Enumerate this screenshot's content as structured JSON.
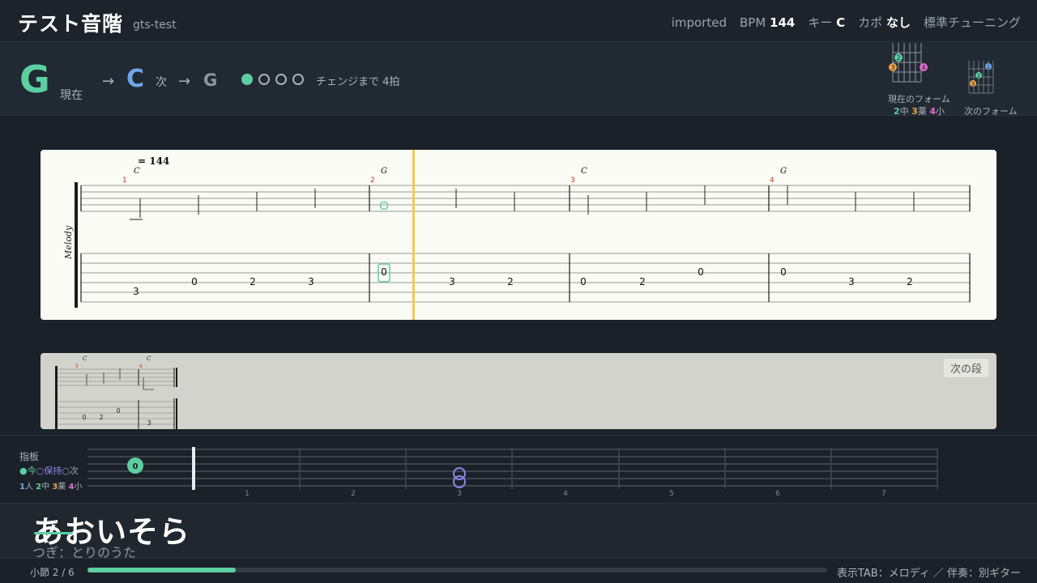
{
  "header": {
    "title": "テスト音階",
    "subtitle": "gts-test",
    "source": "imported",
    "bpm_label": "BPM",
    "bpm_value": "144",
    "key_label": "キー",
    "key_value": "C",
    "capo_label": "カポ",
    "capo_value": "なし",
    "tuning": "標準チューニング"
  },
  "chords": {
    "current": "G",
    "current_label": "現在",
    "arrow": "→",
    "next": "C",
    "next_label": "次",
    "after": "G",
    "beats_total": 4,
    "beats_done": 1,
    "change_text": "チェンジまで 4拍"
  },
  "diagrams": {
    "current_label": "現在のフォーム",
    "next_label": "次のフォーム",
    "finger_legend": [
      {
        "num": "2",
        "text": "中",
        "color": "#5ccfa0"
      },
      {
        "num": "3",
        "text": "薬",
        "color": "#f0a24a"
      },
      {
        "num": "4",
        "text": "小",
        "color": "#e46bd0"
      }
    ],
    "current_dots": [
      "2",
      "3",
      "4"
    ],
    "next_dots": [
      "1",
      "2",
      "3"
    ]
  },
  "score": {
    "tempo": "= 144",
    "track_name": "Melody",
    "measures": [
      {
        "num": "1",
        "chord": "C"
      },
      {
        "num": "2",
        "chord": "G"
      },
      {
        "num": "3",
        "chord": "C"
      },
      {
        "num": "4",
        "chord": "G"
      }
    ],
    "tab_numbers": [
      "3",
      "0",
      "2",
      "3",
      "0",
      "3",
      "2",
      "0",
      "2",
      "0",
      "0",
      "3",
      "2"
    ],
    "next_line_button": "次の段",
    "next_measures": [
      {
        "num": "5",
        "chord": "C"
      },
      {
        "num": "6",
        "chord": "C"
      }
    ],
    "next_tab_numbers": [
      "0",
      "2",
      "0",
      "3"
    ]
  },
  "fretboard": {
    "title": "指板",
    "legend_now": "●今",
    "legend_hold": "○保持",
    "legend_next": "○次",
    "fingers": [
      {
        "num": "1",
        "text": "人",
        "color": "#6ea6ea"
      },
      {
        "num": "2",
        "text": "中",
        "color": "#5ccfa0"
      },
      {
        "num": "3",
        "text": "薬",
        "color": "#f0a24a"
      },
      {
        "num": "4",
        "text": "小",
        "color": "#e46bd0"
      }
    ],
    "fret_numbers": [
      "1",
      "2",
      "3",
      "4",
      "5",
      "6",
      "7"
    ],
    "open_marker": "0"
  },
  "lyrics": {
    "current": "あおいそら",
    "next": "つぎ：とりのうた"
  },
  "status": {
    "measure_text": "小節 2 / 6",
    "progress": 0.2,
    "display_info": "表示TAB：メロディ ／ 伴奏：別ギター"
  },
  "colors": {
    "accent": "#5ccfa0",
    "next_chord": "#6ea6ea",
    "playhead": "#f5c84c",
    "measure_number": "#c0392b"
  }
}
